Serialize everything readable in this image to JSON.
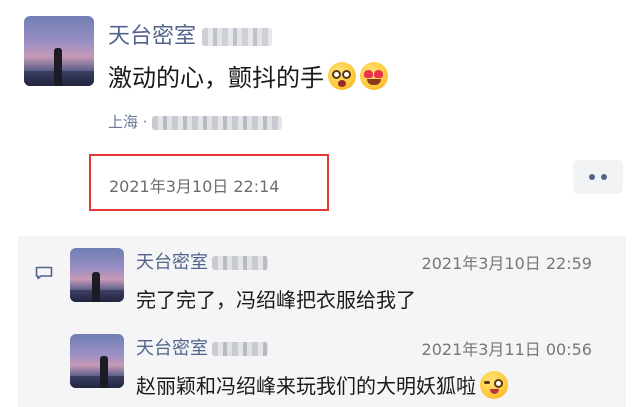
{
  "post": {
    "author": "天台密室",
    "content": "激动的心，颤抖的手",
    "emojis": [
      "dizzy-face-emoji",
      "heart-eyes-emoji"
    ],
    "location_prefix": "上海 ·",
    "timestamp": "2021年3月10日 22:14",
    "highlight_color": "#e53935"
  },
  "comments": [
    {
      "author": "天台密室",
      "time": "2021年3月10日 22:59",
      "text": "完了完了，冯绍峰把衣服给我了"
    },
    {
      "author": "天台密室",
      "time": "2021年3月11日 00:56",
      "text": "赵丽颖和冯绍峰来玩我们的大明妖狐啦",
      "emoji": "wink-emoji"
    }
  ],
  "colors": {
    "name_link": "#52648c",
    "comment_bg": "#f5f5f7"
  }
}
